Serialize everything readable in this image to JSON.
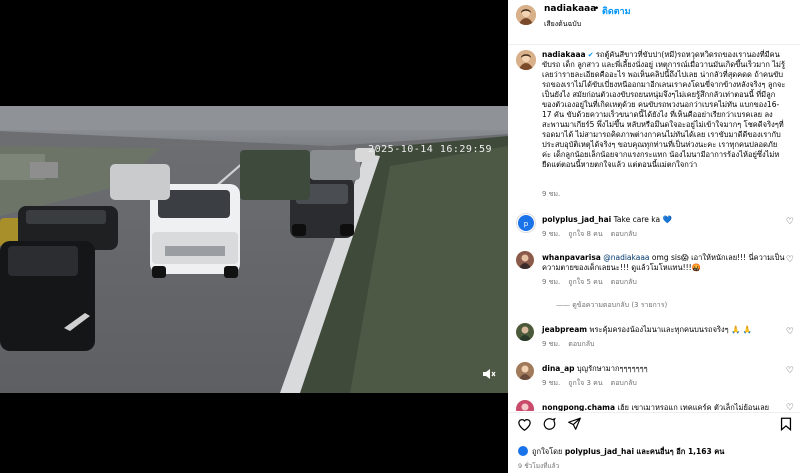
{
  "post": {
    "username": "nadiakaaa",
    "follow_label": "ติดตาม",
    "separator": "•",
    "subtitle": "เสียงต้นฉบับ"
  },
  "video": {
    "timestamp": "2025-10-14 16:29:59",
    "mute_icon": "speaker-muted-icon"
  },
  "caption": {
    "username": "nadiakaaa",
    "verified_icon": "verified-badge-icon",
    "text": "รถตู้คันสีขาวที่ขับปา(หมี)รถหวุดหวิดรถของเรานองที่มีคนขับรถ เด็ก ลูกสาว และพี่เลี้ยงนั่งอยู่ เหตุการณ์เมื่อวานมันเกิดขึ้นเร็วมาก ไม่รู้เลยว่ารายละเอียดคืออะไร พอเห็นคลิปนี้ถึงไปเลย น่ากลัวที่สุดคดด ถ้าคนขับรถของเราไม่ได้ขับเบี่ยงหนีออกมาอีกเลนเราคงโดนขี่จากข้างหลังจริงๆ ลูกจะเป็นยังไง สมัยก่อนตัวเองขับรถยนหนุ่มจึงๆไม่เคยรู้สึกกลัวเท่าตอนนี้ ที่มีลูกของตัวเองอยู่ในที่เกิดเหตุด้วย คนขับรถพวงนอกว่าเบรคไม่ทัน แบกของ16-17 คัน ขับด้วยความเร็วขนาดนี้ได้ยังไง ที่เห็นคืออย่าเรียกว่าเบรคเลย ลงสะพานมาเกียร์5 พึ่งไม่ขึ้น หลับหรือมึนดใจอะอยู่ไม่เข้าใจมากๆ โชคดีจริงๆที่รอดมาได้ ไม่สามารถคิดภาพต่างกาคนไม่ทันได้เลย เราขับมาดีดีของเรากับประสบอุบัติเหตุได้จริงๆ ขอบคุณทุกท่านที่เป็นห่วงนะคะ เราทุกคนปลอดภัยค่ะ เด็กลูกน้อยเล็กน้อยจากแรงกระแทก น้องไมนามีอาการร้องไห้อยู่ซึ่งไม่หยืดแต่ตอนนี้หายตกใจแล้ว แต่ตอนนี้แม่ตกใจกว่า",
    "time": "9 ชม."
  },
  "comments": [
    {
      "username": "polyplus_jad_hai",
      "text": "Take care ka",
      "emoji": "💙",
      "time": "9 ชม.",
      "likes": "ถูกใจ 8 คน",
      "reply": "ตอบกลับ",
      "avatar_color": "#1a73e8"
    },
    {
      "username": "whanpavarisa",
      "mention": "@nadiakaaa",
      "text": "omg sis😱 เอาให้หนักเลย!!! นี่ความเป็นความตายของเด็กเลยนะ!!! ดูแล้วโมโหแทน!!!🤬",
      "time": "9 ชม.",
      "likes": "ถูกใจ 5 คน",
      "reply": "ตอบกลับ",
      "view_replies": "ดูข้อความตอบกลับ (3 รายการ)",
      "avatar_color": "#8a5a4a"
    },
    {
      "username": "jeabpream",
      "text": "พระคุ้มครองน้องไมนาและทุกคนบนรถจริงๆ 🙏 🙏",
      "time": "9 ชม.",
      "likes": "",
      "reply": "ตอบกลับ",
      "avatar_color": "#4a5a3a"
    },
    {
      "username": "dina_ap",
      "text": "บุญรักษามากๆๆๆๆๆๆๆ",
      "time": "9 ชม.",
      "likes": "ถูกใจ 3 คน",
      "reply": "ตอบกลับ",
      "avatar_color": "#a07a5a"
    },
    {
      "username": "nongpong.chama",
      "text": "เฮ้ย เขาเมาหรอแก เทคแคร์ค ตัวเล็กไม่ย้อนเลย",
      "time": "",
      "likes": "",
      "reply": "",
      "avatar_color": "#c94a6a"
    }
  ],
  "footer": {
    "liked_by_prefix": "ถูกใจโดย",
    "liked_by_user": "polyplus_jad_hai",
    "liked_by_suffix": "และคนอื่นๆ อีก 1,163 คน",
    "time": "9 ชั่วโมงที่แล้ว"
  }
}
